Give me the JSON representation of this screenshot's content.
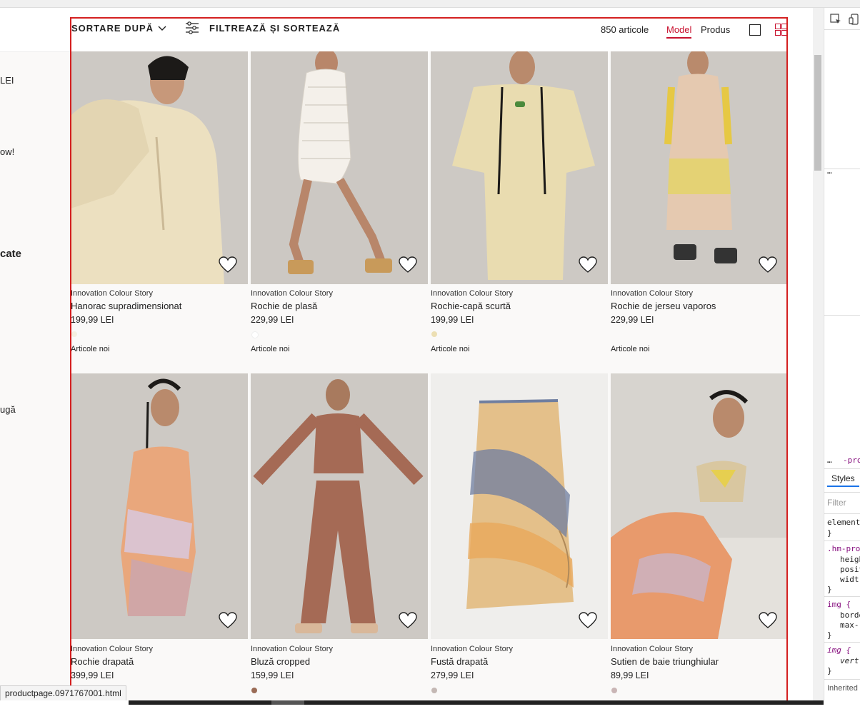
{
  "toolbar": {
    "sort_label": "SORTARE DUPĂ",
    "filter_label": "FILTREAZĂ ȘI SORTEAZĂ",
    "count": "850 articole",
    "view_model": "Model",
    "view_product": "Produs"
  },
  "left_panel": {
    "texts": [
      "LEI",
      "ow!",
      "cate",
      "ugă"
    ]
  },
  "status_url": "productpage.0971767001.html",
  "products": [
    {
      "brand": "Innovation Colour Story",
      "name": "Hanorac supradimensionat",
      "price": "199,99 LEI",
      "swatch": "#f4efe0",
      "badge": "Articole noi"
    },
    {
      "brand": "Innovation Colour Story",
      "name": "Rochie de plasă",
      "price": "229,99 LEI",
      "swatch": "#ffffff",
      "badge": "Articole noi"
    },
    {
      "brand": "Innovation Colour Story",
      "name": "Rochie-capă scurtă",
      "price": "199,99 LEI",
      "swatch": "#ecdfb3",
      "badge": "Articole noi"
    },
    {
      "brand": "Innovation Colour Story",
      "name": "Rochie de jerseu vaporos",
      "price": "229,99 LEI",
      "swatch": "",
      "badge": "Articole noi"
    },
    {
      "brand": "Innovation Colour Story",
      "name": "Rochie drapată",
      "price": "399,99 LEI",
      "swatch": "",
      "badge": ""
    },
    {
      "brand": "Innovation Colour Story",
      "name": "Bluză cropped",
      "price": "159,99 LEI",
      "swatch": "#9a6b55",
      "badge": ""
    },
    {
      "brand": "Innovation Colour Story",
      "name": "Fustă drapată",
      "price": "279,99 LEI",
      "swatch": "#c4b8b4",
      "badge": ""
    },
    {
      "brand": "Innovation Colour Story",
      "name": "Sutien de baie triunghiular",
      "price": "89,99 LEI",
      "swatch": "#c9b5b5",
      "badge": ""
    }
  ],
  "devtools": {
    "tab_styles": "Styles",
    "filter_placeholder": "Filter",
    "dom_crumb": "-pro",
    "rules": [
      "element",
      "}",
      ".hm-pro",
      "heigh",
      "posit",
      "widt",
      "}",
      "img {",
      "borde",
      "max-",
      "}",
      "img {",
      "vert",
      "}",
      "Inherited"
    ]
  },
  "colors": {
    "accent_red": "#c8102e",
    "frame_red": "#d42020",
    "page_bg": "#faf9f8"
  },
  "icons": [
    "chevron-down-icon",
    "sliders-icon",
    "single-view-icon",
    "grid-view-icon",
    "heart-icon"
  ]
}
